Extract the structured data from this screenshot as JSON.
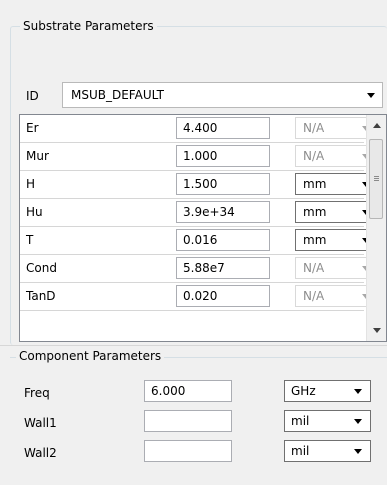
{
  "substrate": {
    "title": "Substrate Parameters",
    "id_label": "ID",
    "id_value": "MSUB_DEFAULT",
    "rows": [
      {
        "name": "Er",
        "value": "4.400",
        "unit": "N/A",
        "unit_enabled": false
      },
      {
        "name": "Mur",
        "value": "1.000",
        "unit": "N/A",
        "unit_enabled": false
      },
      {
        "name": "H",
        "value": "1.500",
        "unit": "mm",
        "unit_enabled": true
      },
      {
        "name": "Hu",
        "value": "3.9e+34",
        "unit": "mm",
        "unit_enabled": true
      },
      {
        "name": "T",
        "value": "0.016",
        "unit": "mm",
        "unit_enabled": true
      },
      {
        "name": "Cond",
        "value": "5.88e7",
        "unit": "N/A",
        "unit_enabled": false
      },
      {
        "name": "TanD",
        "value": "0.020",
        "unit": "N/A",
        "unit_enabled": false
      }
    ]
  },
  "component": {
    "title": "Component Parameters",
    "rows": [
      {
        "name": "Freq",
        "value": "6.000",
        "unit": "GHz"
      },
      {
        "name": "Wall1",
        "value": "",
        "unit": "mil"
      },
      {
        "name": "Wall2",
        "value": "",
        "unit": "mil"
      }
    ]
  }
}
